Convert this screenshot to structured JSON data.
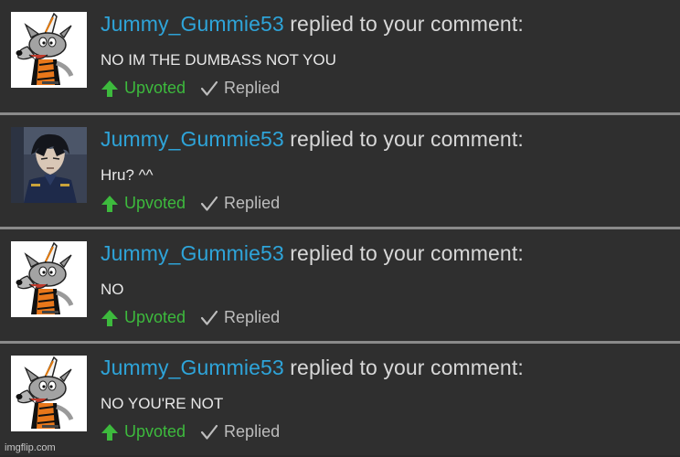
{
  "notifications": [
    {
      "username": "Jummy_Gummie53",
      "action": "replied to your comment:",
      "comment": "NO IM THE DUMBASS NOT YOU",
      "upvote_label": "Upvoted",
      "reply_label": "Replied",
      "avatar": "cartoon-wolf-avatar"
    },
    {
      "username": "Jummy_Gummie53",
      "action": "replied to your comment:",
      "comment": "Hru? ^^",
      "upvote_label": "Upvoted",
      "reply_label": "Replied",
      "avatar": "anime-soldier-avatar"
    },
    {
      "username": "Jummy_Gummie53",
      "action": "replied to your comment:",
      "comment": "NO",
      "upvote_label": "Upvoted",
      "reply_label": "Replied",
      "avatar": "cartoon-wolf-avatar"
    },
    {
      "username": "Jummy_Gummie53",
      "action": "replied to your comment:",
      "comment": "NO YOU'RE NOT",
      "upvote_label": "Upvoted",
      "reply_label": "Replied",
      "avatar": "cartoon-wolf-avatar"
    }
  ],
  "watermark": "imgflip.com",
  "colors": {
    "username": "#2ea4d9",
    "upvoted": "#3dba3d",
    "background": "#2f2f2f"
  }
}
